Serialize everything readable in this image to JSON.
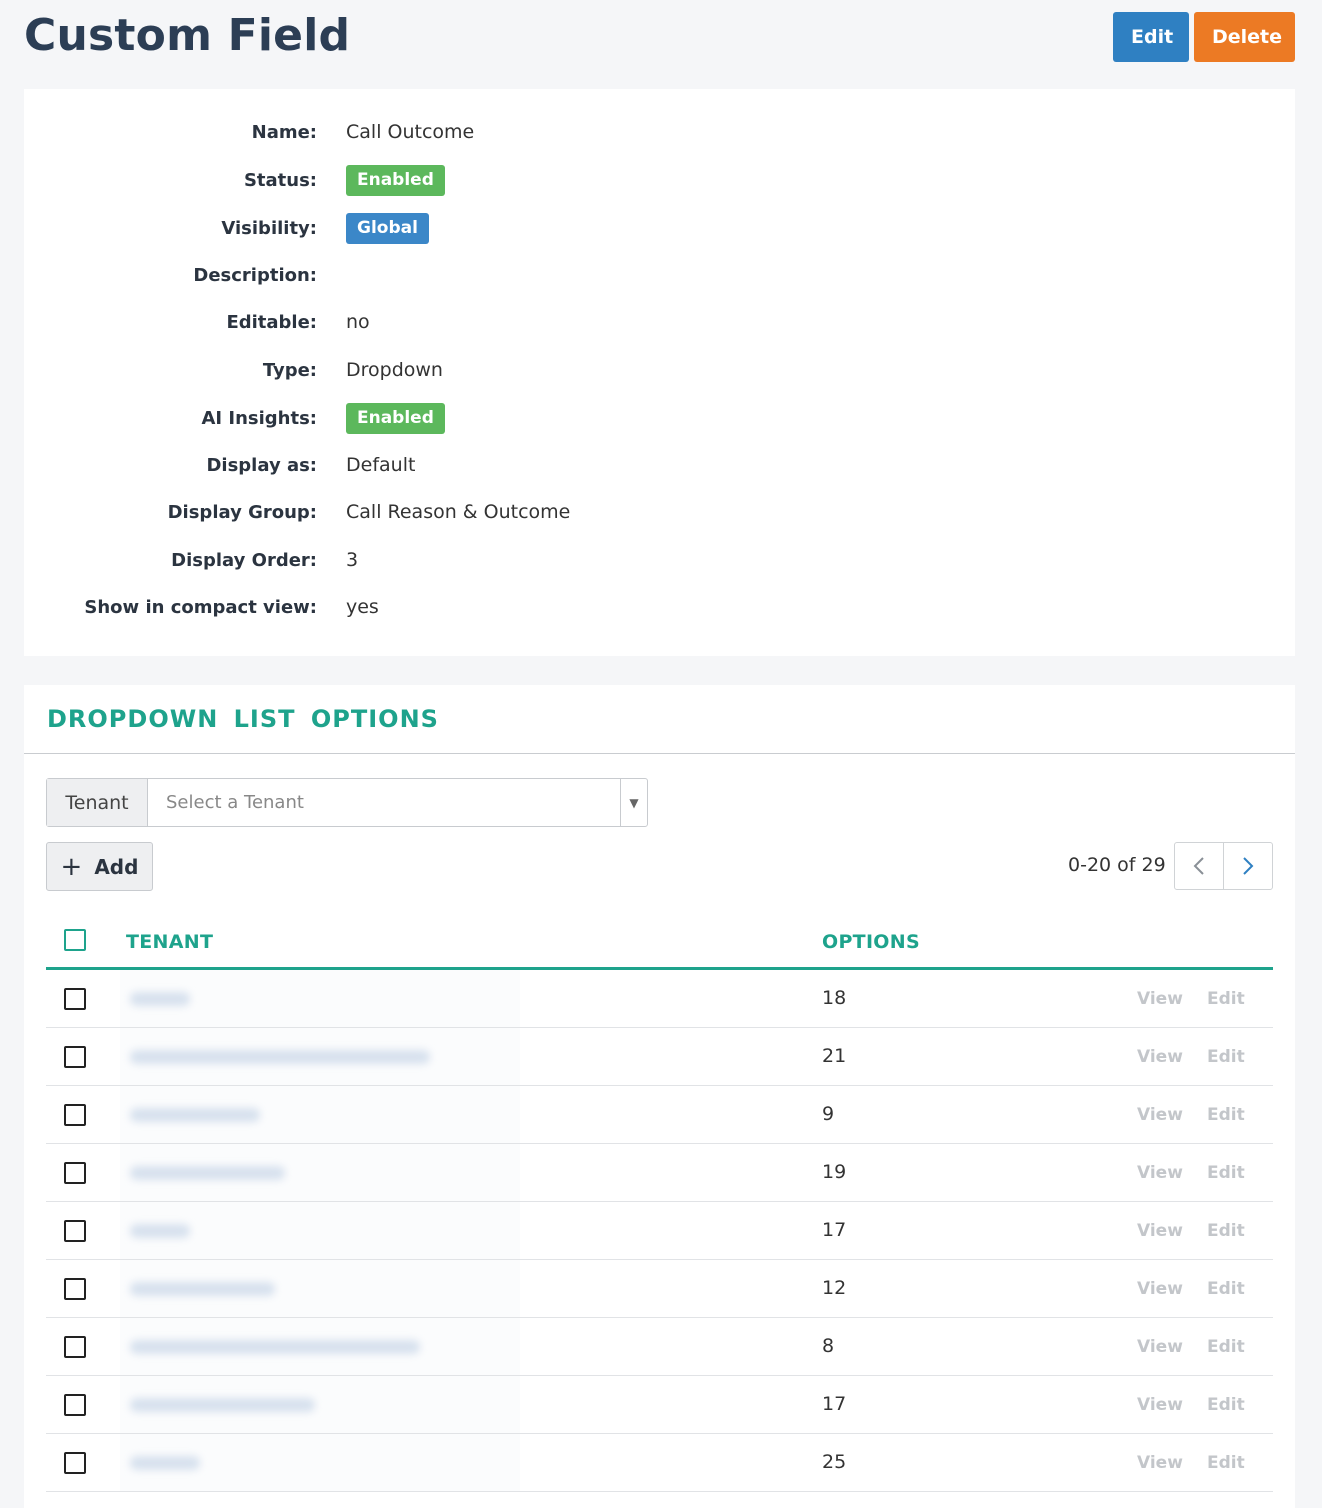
{
  "page": {
    "title": "Custom Field"
  },
  "header": {
    "edit_label": "Edit",
    "delete_label": "Delete"
  },
  "details": {
    "name_label": "Name:",
    "name_value": "Call Outcome",
    "status_label": "Status:",
    "status_value": "Enabled",
    "visibility_label": "Visibility:",
    "visibility_value": "Global",
    "description_label": "Description:",
    "description_value": "",
    "editable_label": "Editable:",
    "editable_value": "no",
    "type_label": "Type:",
    "type_value": "Dropdown",
    "ai_label": "AI Insights:",
    "ai_value": "Enabled",
    "display_as_label": "Display as:",
    "display_as_value": "Default",
    "display_group_label": "Display Group:",
    "display_group_value": "Call Reason & Outcome",
    "display_order_label": "Display Order:",
    "display_order_value": "3",
    "compact_label": "Show in compact view:",
    "compact_value": "yes"
  },
  "options": {
    "section_title": "DROPDOWN LIST OPTIONS",
    "tenant_addon": "Tenant",
    "tenant_placeholder": "Select a Tenant",
    "add_label": "Add",
    "pager_text": "0-20 of 29",
    "col_tenant": "TENANT",
    "col_options": "OPTIONS",
    "view_label": "View",
    "edit_label": "Edit",
    "rows": [
      {
        "options": "18"
      },
      {
        "options": "21"
      },
      {
        "options": "9"
      },
      {
        "options": "19"
      },
      {
        "options": "17"
      },
      {
        "options": "12"
      },
      {
        "options": "8"
      },
      {
        "options": "17"
      },
      {
        "options": "25"
      }
    ]
  },
  "colors": {
    "accent": "#1ea38c",
    "edit_button": "#2f80c2",
    "delete_button": "#ec7a24",
    "badge_enabled": "#5cb85c",
    "badge_global": "#3b87c8"
  },
  "icons": {
    "add": "plus-icon",
    "prev": "chevron-left-icon",
    "next": "chevron-right-icon",
    "dropdown": "caret-down-icon"
  }
}
